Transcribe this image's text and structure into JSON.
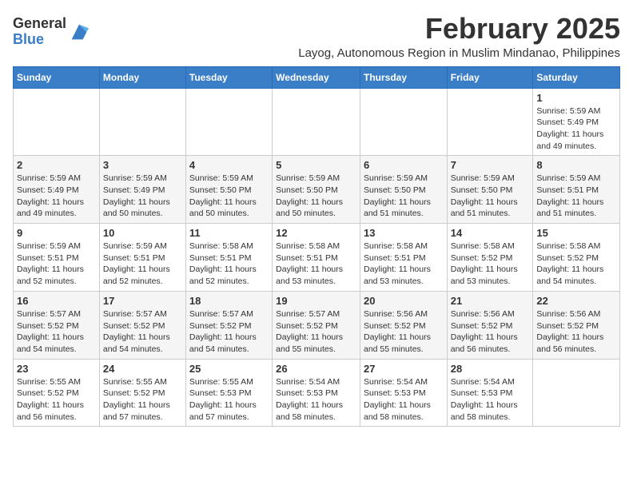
{
  "logo": {
    "general": "General",
    "blue": "Blue"
  },
  "title": "February 2025",
  "location": "Layog, Autonomous Region in Muslim Mindanao, Philippines",
  "days_of_week": [
    "Sunday",
    "Monday",
    "Tuesday",
    "Wednesday",
    "Thursday",
    "Friday",
    "Saturday"
  ],
  "weeks": [
    [
      {
        "day": "",
        "info": ""
      },
      {
        "day": "",
        "info": ""
      },
      {
        "day": "",
        "info": ""
      },
      {
        "day": "",
        "info": ""
      },
      {
        "day": "",
        "info": ""
      },
      {
        "day": "",
        "info": ""
      },
      {
        "day": "1",
        "info": "Sunrise: 5:59 AM\nSunset: 5:49 PM\nDaylight: 11 hours\nand 49 minutes."
      }
    ],
    [
      {
        "day": "2",
        "info": "Sunrise: 5:59 AM\nSunset: 5:49 PM\nDaylight: 11 hours\nand 49 minutes."
      },
      {
        "day": "3",
        "info": "Sunrise: 5:59 AM\nSunset: 5:49 PM\nDaylight: 11 hours\nand 50 minutes."
      },
      {
        "day": "4",
        "info": "Sunrise: 5:59 AM\nSunset: 5:50 PM\nDaylight: 11 hours\nand 50 minutes."
      },
      {
        "day": "5",
        "info": "Sunrise: 5:59 AM\nSunset: 5:50 PM\nDaylight: 11 hours\nand 50 minutes."
      },
      {
        "day": "6",
        "info": "Sunrise: 5:59 AM\nSunset: 5:50 PM\nDaylight: 11 hours\nand 51 minutes."
      },
      {
        "day": "7",
        "info": "Sunrise: 5:59 AM\nSunset: 5:50 PM\nDaylight: 11 hours\nand 51 minutes."
      },
      {
        "day": "8",
        "info": "Sunrise: 5:59 AM\nSunset: 5:51 PM\nDaylight: 11 hours\nand 51 minutes."
      }
    ],
    [
      {
        "day": "9",
        "info": "Sunrise: 5:59 AM\nSunset: 5:51 PM\nDaylight: 11 hours\nand 52 minutes."
      },
      {
        "day": "10",
        "info": "Sunrise: 5:59 AM\nSunset: 5:51 PM\nDaylight: 11 hours\nand 52 minutes."
      },
      {
        "day": "11",
        "info": "Sunrise: 5:58 AM\nSunset: 5:51 PM\nDaylight: 11 hours\nand 52 minutes."
      },
      {
        "day": "12",
        "info": "Sunrise: 5:58 AM\nSunset: 5:51 PM\nDaylight: 11 hours\nand 53 minutes."
      },
      {
        "day": "13",
        "info": "Sunrise: 5:58 AM\nSunset: 5:51 PM\nDaylight: 11 hours\nand 53 minutes."
      },
      {
        "day": "14",
        "info": "Sunrise: 5:58 AM\nSunset: 5:52 PM\nDaylight: 11 hours\nand 53 minutes."
      },
      {
        "day": "15",
        "info": "Sunrise: 5:58 AM\nSunset: 5:52 PM\nDaylight: 11 hours\nand 54 minutes."
      }
    ],
    [
      {
        "day": "16",
        "info": "Sunrise: 5:57 AM\nSunset: 5:52 PM\nDaylight: 11 hours\nand 54 minutes."
      },
      {
        "day": "17",
        "info": "Sunrise: 5:57 AM\nSunset: 5:52 PM\nDaylight: 11 hours\nand 54 minutes."
      },
      {
        "day": "18",
        "info": "Sunrise: 5:57 AM\nSunset: 5:52 PM\nDaylight: 11 hours\nand 54 minutes."
      },
      {
        "day": "19",
        "info": "Sunrise: 5:57 AM\nSunset: 5:52 PM\nDaylight: 11 hours\nand 55 minutes."
      },
      {
        "day": "20",
        "info": "Sunrise: 5:56 AM\nSunset: 5:52 PM\nDaylight: 11 hours\nand 55 minutes."
      },
      {
        "day": "21",
        "info": "Sunrise: 5:56 AM\nSunset: 5:52 PM\nDaylight: 11 hours\nand 56 minutes."
      },
      {
        "day": "22",
        "info": "Sunrise: 5:56 AM\nSunset: 5:52 PM\nDaylight: 11 hours\nand 56 minutes."
      }
    ],
    [
      {
        "day": "23",
        "info": "Sunrise: 5:55 AM\nSunset: 5:52 PM\nDaylight: 11 hours\nand 56 minutes."
      },
      {
        "day": "24",
        "info": "Sunrise: 5:55 AM\nSunset: 5:52 PM\nDaylight: 11 hours\nand 57 minutes."
      },
      {
        "day": "25",
        "info": "Sunrise: 5:55 AM\nSunset: 5:53 PM\nDaylight: 11 hours\nand 57 minutes."
      },
      {
        "day": "26",
        "info": "Sunrise: 5:54 AM\nSunset: 5:53 PM\nDaylight: 11 hours\nand 58 minutes."
      },
      {
        "day": "27",
        "info": "Sunrise: 5:54 AM\nSunset: 5:53 PM\nDaylight: 11 hours\nand 58 minutes."
      },
      {
        "day": "28",
        "info": "Sunrise: 5:54 AM\nSunset: 5:53 PM\nDaylight: 11 hours\nand 58 minutes."
      },
      {
        "day": "",
        "info": ""
      }
    ]
  ]
}
